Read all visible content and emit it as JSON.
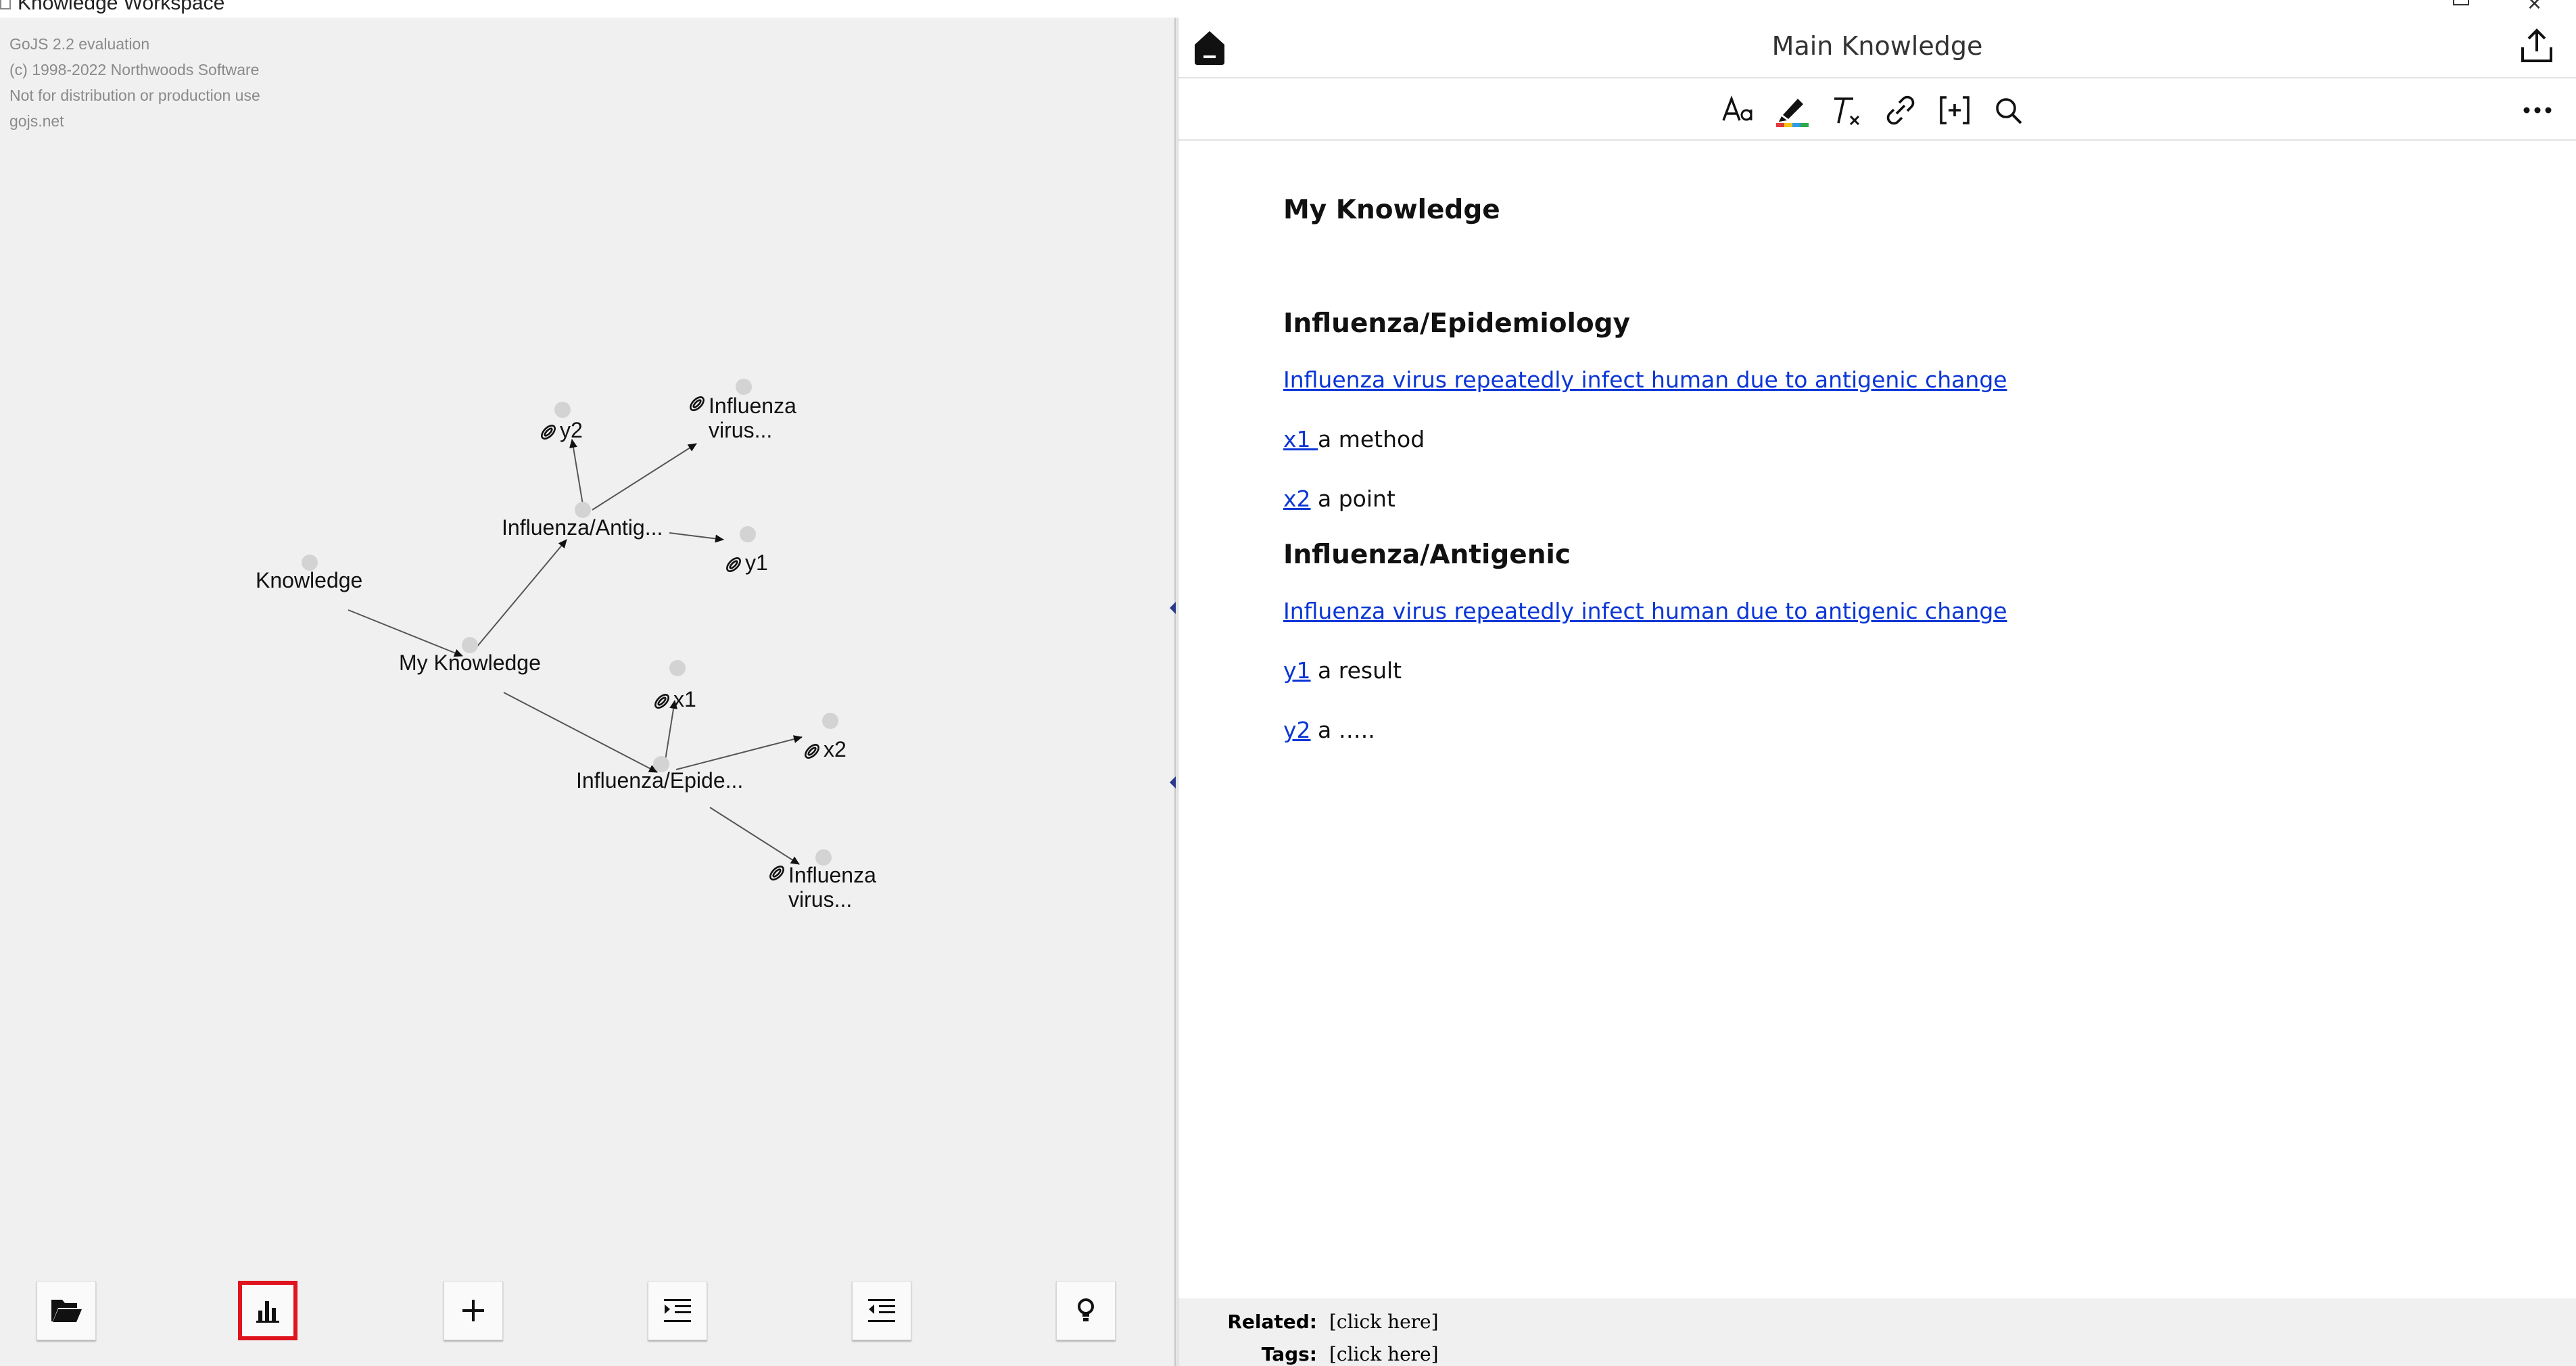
{
  "window": {
    "title": "Knowledge Workspace"
  },
  "watermark": {
    "line1": "GoJS 2.2 evaluation",
    "line2": "(c) 1998-2022 Northwoods Software",
    "line3": "Not for distribution or production use",
    "line4": "gojs.net"
  },
  "diagram": {
    "nodes": {
      "knowledge": "Knowledge",
      "my_knowledge": "My Knowledge",
      "antigenic": "Influenza/Antig...",
      "epidemiology": "Influenza/Epide...",
      "y2": "y2",
      "y1": "y1",
      "x1": "x1",
      "x2": "x2",
      "virus_top": "Influenza virus...",
      "virus_bottom": "Influenza virus..."
    }
  },
  "bottom_toolbar": {
    "buttons": [
      {
        "name": "open-folder-button",
        "icon": "folder-open-icon",
        "selected": false
      },
      {
        "name": "chart-button",
        "icon": "bar-chart-icon",
        "selected": true
      },
      {
        "name": "add-button",
        "icon": "plus-icon",
        "selected": false
      },
      {
        "name": "indent-button",
        "icon": "indent-icon",
        "selected": false
      },
      {
        "name": "outdent-button",
        "icon": "outdent-icon",
        "selected": false
      },
      {
        "name": "idea-button",
        "icon": "lightbulb-icon",
        "selected": false
      }
    ],
    "selected_color": "#e0141e"
  },
  "note": {
    "title": "Main Knowledge",
    "toolbar": [
      "text-format-icon",
      "highlighter-icon",
      "clear-format-icon",
      "link-icon",
      "insert-bracket-icon",
      "search-icon"
    ],
    "heading": "My Knowledge",
    "section1": {
      "heading": "Influenza/Epidemiology",
      "link": "Influenza virus repeatedly infect human due to antigenic change",
      "items": [
        {
          "link": "x1 ",
          "text": "a method"
        },
        {
          "link": "x2",
          "text": " a point"
        }
      ]
    },
    "section2": {
      "heading": "Influenza/Antigenic",
      "link": "Influenza virus repeatedly infect human due to antigenic change",
      "items": [
        {
          "link": "y1",
          "text": " a result"
        },
        {
          "link": "y2",
          "text": " a ….."
        }
      ]
    },
    "link_color": "#0b36d6"
  },
  "footer": {
    "related_label": "Related:",
    "related_value": "[click here]",
    "tags_label": "Tags:",
    "tags_value": "[click here]"
  }
}
